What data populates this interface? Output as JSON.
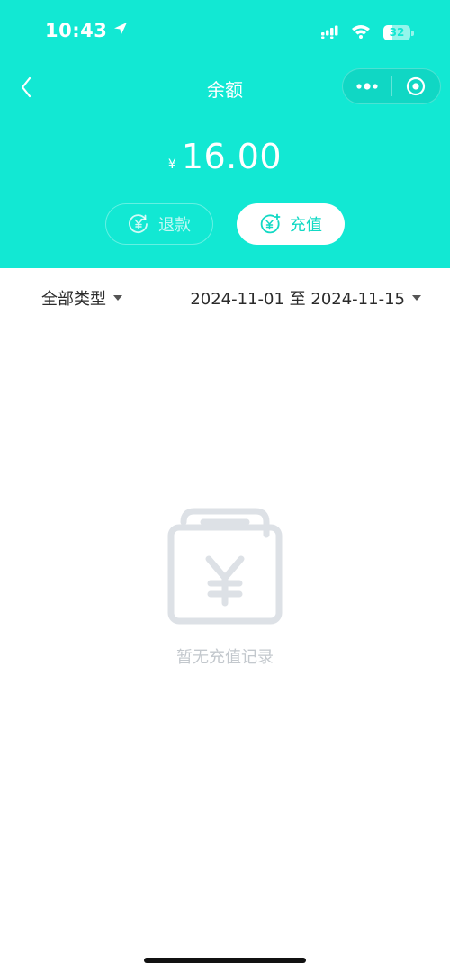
{
  "status_bar": {
    "time": "10:43",
    "location_icon": "location-arrow-icon",
    "signal_icon": "cellular-signal-icon",
    "wifi_icon": "wifi-icon",
    "battery_level": "32",
    "battery_fraction": 0.32
  },
  "nav": {
    "back_icon": "chevron-left-icon",
    "title": "余额",
    "more_icon": "more-dots-icon",
    "close_icon": "target-circle-icon"
  },
  "balance": {
    "currency_symbol": "¥",
    "amount": "16.00"
  },
  "actions": {
    "refund_label": "退款",
    "refund_icon": "yuan-circle-icon",
    "recharge_label": "充值",
    "recharge_icon": "yuan-plus-circle-icon"
  },
  "filters": {
    "type_label": "全部类型",
    "date_range": "2024-11-01 至 2024-11-15"
  },
  "empty_state": {
    "icon": "empty-wallet-yuan-icon",
    "message": "暂无充值记录"
  },
  "colors": {
    "brand": "#12e8d3",
    "empty_gray": "#dde1e6"
  }
}
